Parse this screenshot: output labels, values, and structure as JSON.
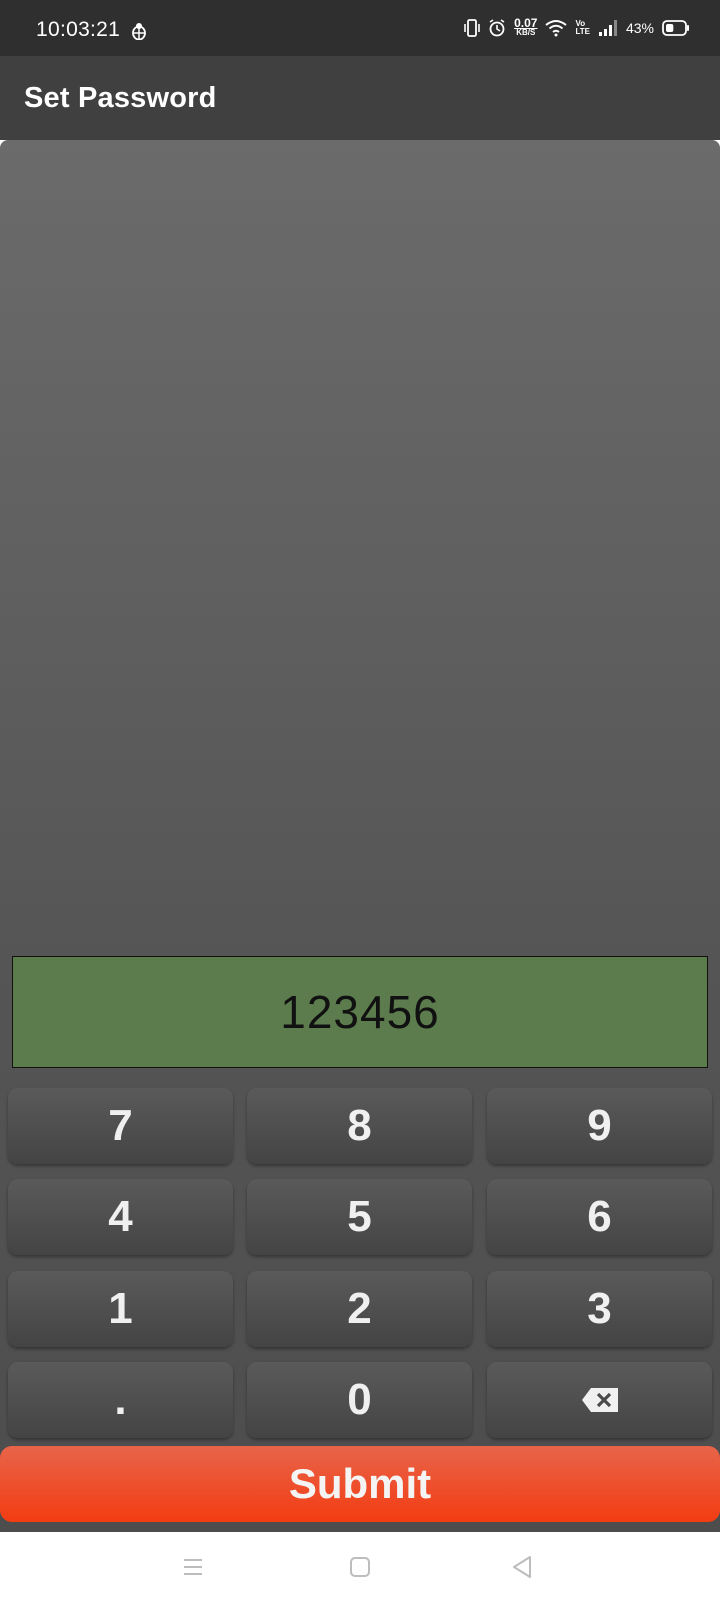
{
  "status_bar": {
    "time": "10:03:21",
    "net_speed_value": "0.07",
    "net_speed_unit": "KB/S",
    "volte_top": "Vo",
    "volte_bottom": "LTE",
    "battery_percent": "43%",
    "battery_level": 0.43,
    "icons": [
      "bug-icon",
      "vibrate-icon",
      "alarm-icon",
      "wifi-icon",
      "signal-icon",
      "battery-icon"
    ]
  },
  "app_bar": {
    "title": "Set Password"
  },
  "display": {
    "value": "123456",
    "background": "#5c7c4e"
  },
  "keypad": {
    "k7": "7",
    "k8": "8",
    "k9": "9",
    "k4": "4",
    "k5": "5",
    "k6": "6",
    "k1": "1",
    "k2": "2",
    "k3": "3",
    "kdot": ".",
    "k0": "0",
    "backspace_icon": "backspace-icon"
  },
  "submit": {
    "label": "Submit",
    "color": "#f33c12"
  },
  "nav_bar": {
    "icons": [
      "menu-icon",
      "home-icon",
      "back-icon"
    ]
  }
}
